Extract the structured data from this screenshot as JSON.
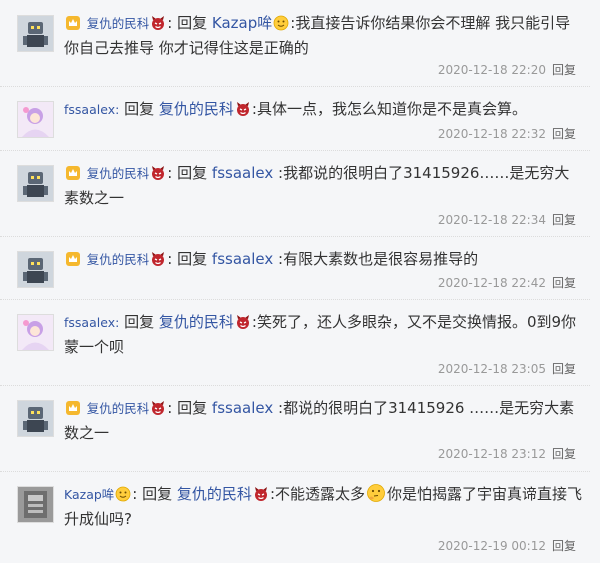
{
  "replies": [
    {
      "user": "复仇的民科",
      "avatar": "robot-avatar",
      "reply_word": "回复",
      "target": "Kazap哞",
      "text": ":我直接告诉你结果你会不理解 我只能引导你自己去推导 你才记得住这是正确的",
      "time": "2020-12-18 22:20",
      "action": "回复"
    },
    {
      "user": "fssaalex:",
      "avatar": "anime-avatar",
      "reply_word": "回复",
      "target": "复仇的民科",
      "text": ":具体一点，我怎么知道你是不是真会算。",
      "time": "2020-12-18 22:32",
      "action": "回复"
    },
    {
      "user": "复仇的民科",
      "avatar": "robot-avatar",
      "reply_word": "回复",
      "target": "fssaalex",
      "text": ":我都说的很明白了31415926……是无穷大素数之一",
      "time": "2020-12-18 22:34",
      "action": "回复"
    },
    {
      "user": "复仇的民科",
      "avatar": "robot-avatar",
      "reply_word": "回复",
      "target": "fssaalex",
      "text": ":有限大素数也是很容易推导的",
      "time": "2020-12-18 22:42",
      "action": "回复"
    },
    {
      "user": "fssaalex:",
      "avatar": "anime-avatar",
      "reply_word": "回复",
      "target": "复仇的民科",
      "text": ":笑死了，还人多眼杂，又不是交换情报。0到9你蒙一个呗",
      "time": "2020-12-18 23:05",
      "action": "回复"
    },
    {
      "user": "复仇的民科",
      "avatar": "robot-avatar",
      "reply_word": "回复",
      "target": "fssaalex",
      "text": ":都说的很明白了31415926 ……是无穷大素数之一",
      "time": "2020-12-18 23:12",
      "action": "回复"
    },
    {
      "user": "Kazap哞",
      "avatar": "gray-avatar",
      "reply_word": "回复",
      "target": "复仇的民科",
      "text_before": ":不能透露太多",
      "text_after": "你是怕揭露了宇宙真谛直接飞升成仙吗?",
      "time": "2020-12-19 00:12",
      "action": "回复"
    }
  ],
  "colors": {
    "username": "#3456a3",
    "meta": "#999999",
    "background": "#f5f6f8"
  },
  "icons": {
    "vip_badge": "crown-badge-icon",
    "level_badge": "devil-face-icon",
    "smile": "smile-emoji-icon",
    "thinking": "thinking-emoji-icon"
  }
}
